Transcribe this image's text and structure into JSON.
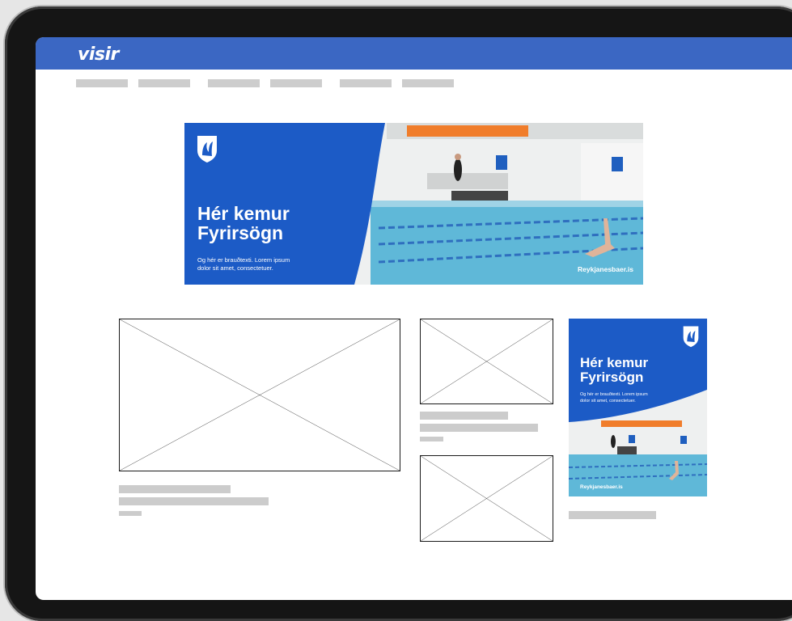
{
  "site": {
    "logo_text": "visir"
  },
  "banner_ad": {
    "headline_line1": "Hér kemur",
    "headline_line2": "Fyrirsögn",
    "body_line1": "Og hér er brauðtexti. Lorem ipsum",
    "body_line2": "dolor sit amet, consectetuer.",
    "url": "Reykjanesbaer.is"
  },
  "side_ad": {
    "headline_line1": "Hér kemur",
    "headline_line2": "Fyrirsögn",
    "body_line1": "Og hér er brauðtexti. Lorem ipsum",
    "body_line2": "dolor sit amet, consectetuer.",
    "url": "Reykjanesbaer.is"
  },
  "colors": {
    "header": "#3b67c3",
    "ad_blue": "#1c5bc6",
    "placeholder_gray": "#cccccc",
    "pool_water": "#5fb8d8"
  },
  "icons": [
    "reykjanesbaer-shield-logo"
  ]
}
